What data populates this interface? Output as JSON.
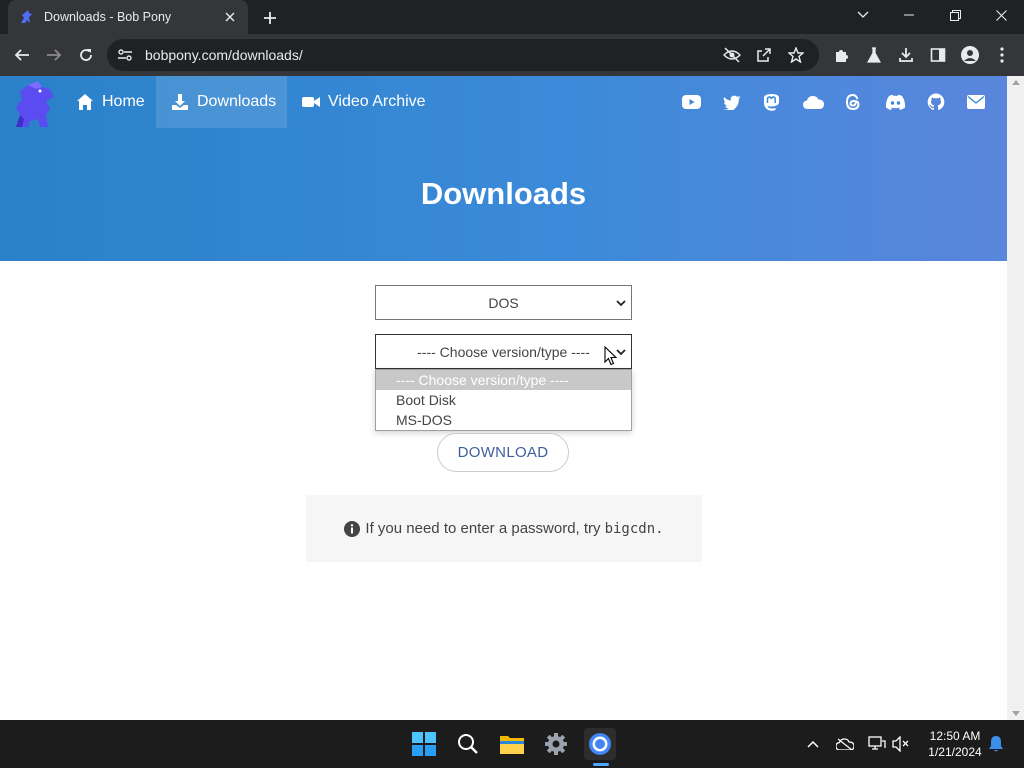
{
  "browser": {
    "tab_title": "Downloads - Bob Pony",
    "url": "bobpony.com/downloads/"
  },
  "nav": {
    "home": "Home",
    "downloads": "Downloads",
    "video_archive": "Video Archive",
    "social_icons": [
      "youtube-icon",
      "twitter-icon",
      "mastodon-icon",
      "cloud-icon",
      "threads-icon",
      "discord-icon",
      "github-icon",
      "mail-icon"
    ]
  },
  "hero": {
    "title": "Downloads"
  },
  "form": {
    "os_select_value": "DOS",
    "version_select_value": "---- Choose version/type ----",
    "version_options": [
      "---- Choose version/type ----",
      "Boot Disk",
      "MS-DOS"
    ],
    "download_label": "DOWNLOAD"
  },
  "note": {
    "text": "If you need to enter a password, try",
    "password": "bigcdn."
  },
  "taskbar": {
    "time": "12:50 AM",
    "date": "1/21/2024"
  },
  "colors": {
    "hero_start": "#2a81c9",
    "hero_end": "#5a86dd",
    "button_text": "#3e5f9e"
  }
}
